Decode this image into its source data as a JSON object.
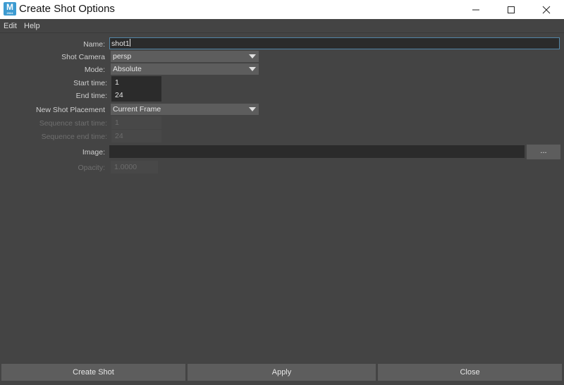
{
  "window": {
    "title": "Create Shot Options",
    "app_icon": {
      "letter": "M",
      "sub": "2024"
    }
  },
  "controls": {
    "minimize_icon": "minimize-icon",
    "maximize_icon": "maximize-icon",
    "close_icon": "close-icon"
  },
  "menu": {
    "items": [
      "Edit",
      "Help"
    ]
  },
  "form": {
    "name": {
      "label": "Name:",
      "value": "shot1"
    },
    "shot_camera": {
      "label": "Shot Camera",
      "value": "persp"
    },
    "mode": {
      "label": "Mode:",
      "value": "Absolute"
    },
    "start_time": {
      "label": "Start time:",
      "value": "1"
    },
    "end_time": {
      "label": "End time:",
      "value": "24"
    },
    "placement": {
      "label": "New Shot Placement",
      "value": "Current Frame"
    },
    "sequence_start": {
      "label": "Sequence start time:",
      "value": "1",
      "enabled": false
    },
    "sequence_end": {
      "label": "Sequence end time:",
      "value": "24",
      "enabled": false
    },
    "image": {
      "label": "Image:",
      "value": "",
      "browse_label": "..."
    },
    "opacity": {
      "label": "Opacity:",
      "value": "1.0000",
      "enabled": false
    }
  },
  "buttons": {
    "create": "Create Shot",
    "apply": "Apply",
    "close": "Close"
  },
  "colors": {
    "background": "#444444",
    "field": "#2b2b2b",
    "button": "#5d5d5d",
    "focus_border": "#5285a6",
    "app_icon": "#3d9bd1"
  }
}
